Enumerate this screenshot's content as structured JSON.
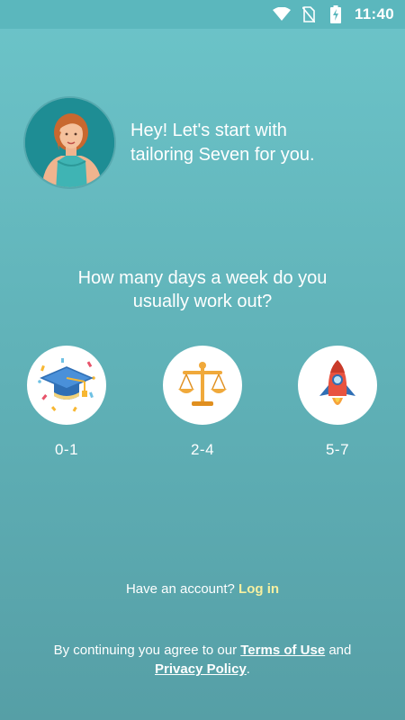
{
  "status_bar": {
    "time": "11:40",
    "icons": [
      "wifi-icon",
      "no-sim-icon",
      "battery-charging-icon"
    ]
  },
  "intro": {
    "avatar_icon": "trainer-avatar-icon",
    "line1": "Hey! Let's start with",
    "line2": "tailoring Seven for you."
  },
  "question": {
    "line1": "How many days a week do you",
    "line2": "usually work out?"
  },
  "options": [
    {
      "icon": "graduation-cap-icon",
      "label": "0-1"
    },
    {
      "icon": "balance-scale-icon",
      "label": "2-4"
    },
    {
      "icon": "rocket-icon",
      "label": "5-7"
    }
  ],
  "account": {
    "prompt": "Have an account?",
    "login": "Log in"
  },
  "terms": {
    "prefix": "By continuing you agree to our",
    "terms_link": "Terms of Use",
    "and": "and",
    "privacy_link": "Privacy Policy",
    "suffix": "."
  },
  "colors": {
    "background_top": "#6cc4c9",
    "background_bottom": "#569fa6",
    "login_accent": "#f7f0a0"
  }
}
